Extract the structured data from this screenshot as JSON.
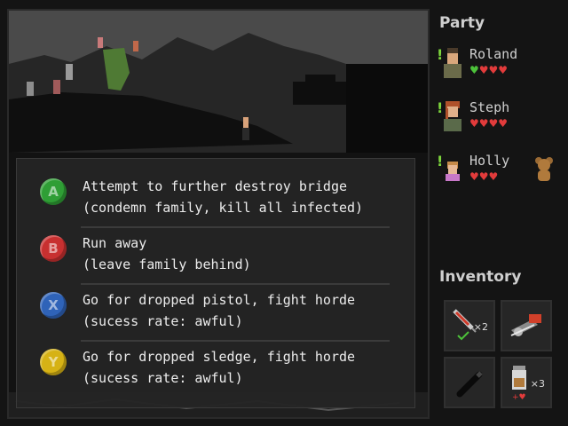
{
  "scene": {
    "description_colors": {
      "sky": "#2b2b2b",
      "ground": "#111111"
    }
  },
  "choices": [
    {
      "button": "A",
      "color": "#2f9e35",
      "line1": "Attempt to further destroy bridge",
      "line2": "(condemn family, kill all infected)"
    },
    {
      "button": "B",
      "color": "#c83030",
      "line1": "Run away",
      "line2": "(leave family behind)"
    },
    {
      "button": "X",
      "color": "#2f63b8",
      "line1": "Go for dropped pistol, fight horde",
      "line2": "(sucess rate: awful)"
    },
    {
      "button": "Y",
      "color": "#d6b215",
      "line1": "Go for dropped sledge, fight horde",
      "line2": "(sucess rate: awful)"
    }
  ],
  "party": {
    "title": "Party",
    "members": [
      {
        "name": "Roland",
        "alert": "!",
        "hearts": "♥♥♥♥",
        "green_hearts": 1
      },
      {
        "name": "Steph",
        "alert": "!",
        "hearts": "♥♥♥♥",
        "green_hearts": 0
      },
      {
        "name": "Holly",
        "alert": "!",
        "hearts": "♥♥♥",
        "green_hearts": 0
      }
    ],
    "companion_icon": "teddy-bear-icon"
  },
  "inventory": {
    "title": "Inventory",
    "items": [
      {
        "icon": "syringe-icon",
        "count": "×2"
      },
      {
        "icon": "chainsaw-icon",
        "count": ""
      },
      {
        "icon": "flashlight-icon",
        "count": ""
      },
      {
        "icon": "medicine-jar-icon",
        "count": "×3"
      }
    ]
  }
}
